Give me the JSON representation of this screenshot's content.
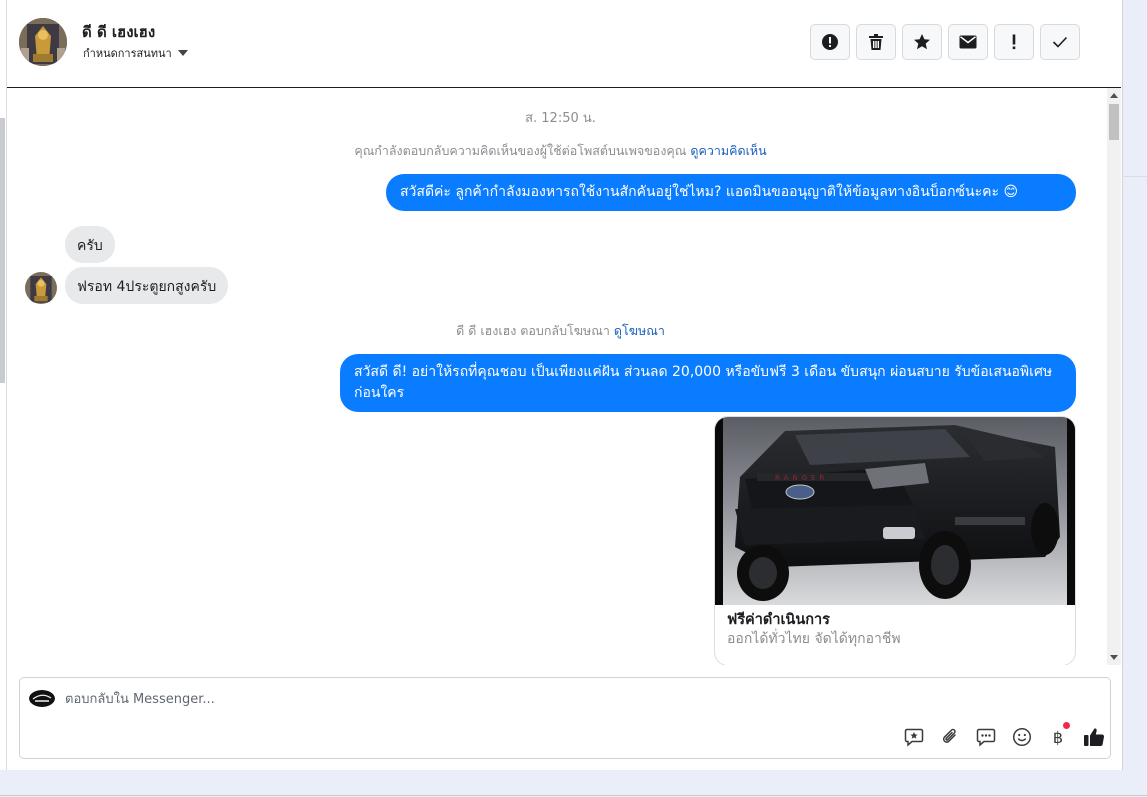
{
  "header": {
    "name": "ดี ดี เฮงเฮง",
    "assign_label": "กำหนดการสนทนา",
    "actions": [
      {
        "icon": "alert-circle-icon",
        "name": "mark-spam-button"
      },
      {
        "icon": "trash-icon",
        "name": "delete-button"
      },
      {
        "icon": "star-icon",
        "name": "star-button"
      },
      {
        "icon": "envelope-icon",
        "name": "mark-unread-button"
      },
      {
        "icon": "exclamation-icon",
        "name": "follow-up-button"
      },
      {
        "icon": "check-icon",
        "name": "mark-done-button"
      }
    ]
  },
  "conversation": {
    "timestamp": "ส. 12:50 น.",
    "system1_text": "คุณกำลังตอบกลับความคิดเห็นของผู้ใช้ต่อโพสต์บนเพจของคุณ",
    "system1_link": "ดูความคิดเห็น",
    "out1": "สวัสดีค่ะ ลูกค้ากำลังมองหารถใช้งานสักคันอยู่ใช่ไหม? แอดมินขออนุญาติให้ข้อมูลทางอินบ็อกซ์นะคะ 😊",
    "in1": "ครับ",
    "in2": "ฟรอท 4ประตูยกสูงครับ",
    "system2_text": "ดี ดี เฮงเฮง ตอบกลับโฆษณา",
    "system2_link": "ดูโฆษณา",
    "out2": "สวัสดี ดี! อย่าให้รถที่คุณชอบ เป็นเพียงแค่ฝัน ส่วนลด 20,000 หรือขับฟรี 3 เดือน ขับสนุก ผ่อนสบาย รับข้อเสนอพิเศษก่อนใคร",
    "card": {
      "title": "ฟรีค่าดำเนินการ",
      "subtitle": "ออกได้ทั่วไทย จัดได้ทุกอาชีพ"
    }
  },
  "composer": {
    "placeholder": "ตอบกลับใน Messenger...",
    "currency_symbol": "฿",
    "tools": [
      "saved-reply-icon",
      "paperclip-icon",
      "chat-bubbles-icon",
      "smiley-icon",
      "baht-icon",
      "thumbs-up-icon"
    ]
  },
  "colors": {
    "outgoing_bubble": "#0a7cff",
    "incoming_bubble": "#e8e9eb",
    "link": "#1c5fbf",
    "notification_dot": "#f02849"
  }
}
